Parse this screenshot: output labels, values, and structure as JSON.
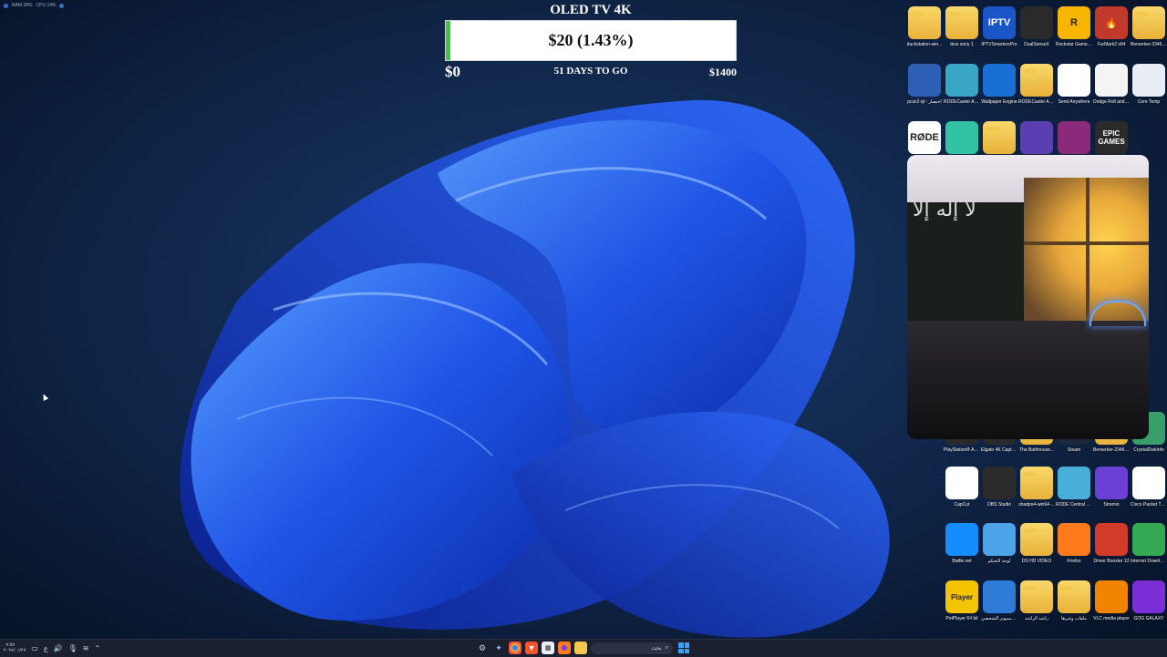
{
  "sysmon": {
    "ram": "RAM 28%",
    "cpu": "CPU 14%"
  },
  "goal": {
    "title": "OLED TV 4K",
    "amount": "$20 (1.43%)",
    "progress_percent": 1.43,
    "min": "$0",
    "days": "51 DAYS TO GO",
    "max": "$1400"
  },
  "icons": [
    {
      "label": "duckstation-win...",
      "icon": "folder-icon"
    },
    {
      "label": "bios sony 1",
      "icon": "folder-icon"
    },
    {
      "label": "IPTVSmartersPro",
      "icon": "iptv-icon",
      "text": "IPTV"
    },
    {
      "label": "DualSenseX",
      "icon": "gamepad-icon"
    },
    {
      "label": "Rockstar Games Launcher",
      "icon": "rockstar-icon",
      "text": "R"
    },
    {
      "label": "FurMark2 x64",
      "icon": "furmark-icon",
      "text": "🔥"
    },
    {
      "label": "Berserker-2346-...",
      "icon": "folder-icon"
    },
    {
      "label": "pcsx2-qt - اختصار",
      "icon": "pcsx2-icon"
    },
    {
      "label": "RODECaster App (2.0.102)",
      "icon": "rodecaster-icon"
    },
    {
      "label": "Wallpaper Engine",
      "icon": "wallpaper-engine-icon"
    },
    {
      "label": "RODECaster App Windows v2.0.105",
      "icon": "folder-icon"
    },
    {
      "label": "Send Anywhere",
      "icon": "send-anywhere-icon"
    },
    {
      "label": "Dodge Roll and Sprint-496-2-30...",
      "icon": "file-icon"
    },
    {
      "label": "Core Temp",
      "icon": "core-temp-icon"
    },
    {
      "label": "",
      "icon": "rode-icon",
      "text": "RØDE"
    },
    {
      "label": "",
      "icon": "streamlabs-icon"
    },
    {
      "label": "",
      "icon": "folder-icon"
    },
    {
      "label": "",
      "icon": "cpuz-icon"
    },
    {
      "label": "",
      "icon": "winrar-icon"
    },
    {
      "label": "Epic Games Launcher",
      "icon": "epic-games-icon",
      "text": "EPIC GAMES"
    },
    {
      "label": "PlayStation® Accessories",
      "icon": "playstation-icon"
    },
    {
      "label": "Elgato 4K Capture Utility",
      "icon": "elgato-icon"
    },
    {
      "label": "The.Bathhouse...",
      "icon": "folder-icon"
    },
    {
      "label": "Steam",
      "icon": "steam-icon"
    },
    {
      "label": "Berserker-2346-...",
      "icon": "folder-icon"
    },
    {
      "label": "CrystalDiskInfo",
      "icon": "crystaldiskinfo-icon"
    },
    {
      "label": "CapCut",
      "icon": "capcut-icon"
    },
    {
      "label": "OBS Studio",
      "icon": "obs-icon"
    },
    {
      "label": "shadps4-win64-...",
      "icon": "folder-icon"
    },
    {
      "label": "RODE Central (2.0.65)",
      "icon": "rode-central-icon"
    },
    {
      "label": "Stremio",
      "icon": "stremio-icon"
    },
    {
      "label": "Cisco Packet Tracer",
      "icon": "cisco-icon"
    },
    {
      "label": "Battle.net",
      "icon": "battlenet-icon"
    },
    {
      "label": "لوحة التحكم",
      "icon": "control-panel-icon"
    },
    {
      "label": "DS HD VIDEO",
      "icon": "folder-icon"
    },
    {
      "label": "Firefox",
      "icon": "firefox-icon"
    },
    {
      "label": "Driver Booster 12",
      "icon": "driver-booster-icon"
    },
    {
      "label": "Internet Downloa...",
      "icon": "idm-icon"
    },
    {
      "label": "PotPlayer 64 bit",
      "icon": "potplayer-icon",
      "text": "Player"
    },
    {
      "label": "هذا الكمبيوتر الشخصي",
      "icon": "this-pc-icon"
    },
    {
      "label": "راشد الراشد",
      "icon": "user-folder-icon"
    },
    {
      "label": "ملفات وغيرها",
      "icon": "folder-icon"
    },
    {
      "label": "VLC media player",
      "icon": "vlc-icon"
    },
    {
      "label": "GOG GALAXY",
      "icon": "gog-galaxy-icon"
    }
  ],
  "webcam": {
    "flag_text": "لا إله إلا"
  },
  "taskbar": {
    "time": "٠٩:٥٧",
    "date": "٢٠٢٤/٠١/٢٧",
    "lang": "ع",
    "search_placeholder": "بحث"
  }
}
